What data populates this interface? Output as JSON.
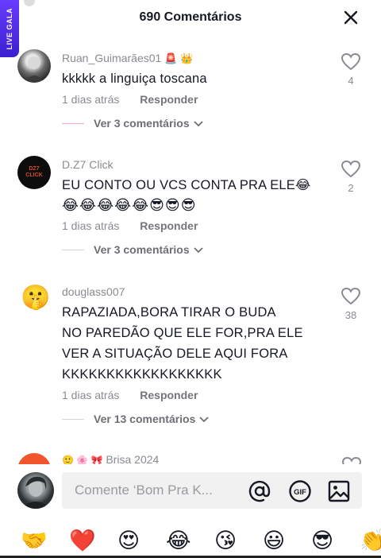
{
  "header": {
    "title": "690 Comentários"
  },
  "side_badge": {
    "label": "LIVE GALA"
  },
  "comments": [
    {
      "username": "Ruan_Guimarães01",
      "username_emoji": "🚨 👑",
      "text": "kkkkk a linguiça toscana",
      "time": "1 dias atrás",
      "reply_label": "Responder",
      "replies_label": "Ver 3 comentários",
      "likes": "4"
    },
    {
      "username": "D.Z7 Click",
      "avatar_text": "DZ7 CLICK",
      "text": "EU CONTO OU VCS CONTA PRA ELE😂",
      "text_line2": "😂😂😂😂😂😎😎😎",
      "time": "1 dias atrás",
      "reply_label": "Responder",
      "replies_label": "Ver 3 comentários",
      "likes": "2"
    },
    {
      "username": "douglass007",
      "avatar_emoji": "🤫",
      "text_lines": [
        "RAPAZIADA,BORA TIRAR O BUDA",
        "NO PAREDÃO QUE ELE FOR,PRA ELE",
        "VER A SITUAÇÃO DELE AQUI FORA",
        "KKKKKKKKKKKKKKKKKK"
      ],
      "time": "1 dias atrás",
      "reply_label": "Responder",
      "replies_label": "Ver 13 comentários",
      "likes": "38"
    },
    {
      "username": "Brisa 2024",
      "username_prefix_emoji": "🙂 🌸 🎀"
    }
  ],
  "input": {
    "placeholder": "Comente ‘Bom Pra K..."
  },
  "quick_emojis": [
    "🤝",
    "❤️",
    "😍",
    "😂",
    "😘",
    "😃",
    "😎",
    "👏"
  ],
  "colors": {
    "accent_red": "#fe2c55",
    "text_primary": "#161823",
    "text_secondary": "#8a8b91"
  },
  "icons": [
    "close-icon",
    "heart-outline-icon",
    "chevron-down-icon",
    "at-icon",
    "gif-icon",
    "image-icon"
  ]
}
